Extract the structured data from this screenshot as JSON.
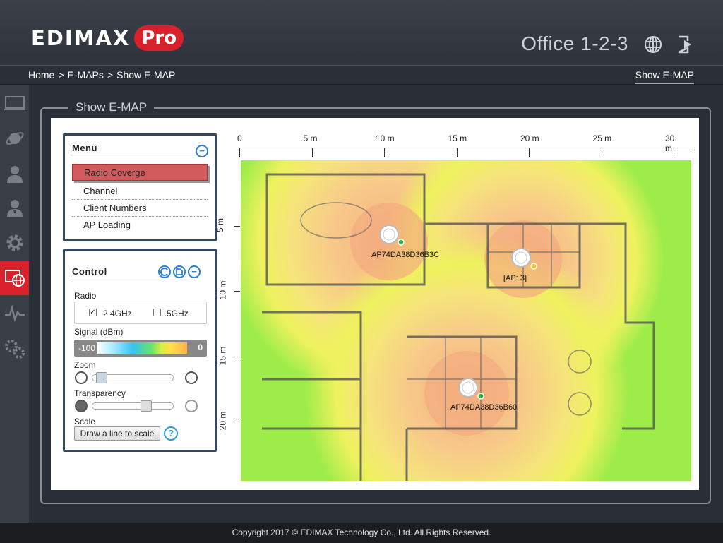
{
  "brand": {
    "logo_main": "EDIMAX",
    "logo_pro": "Pro"
  },
  "header": {
    "site_name": "Office 1-2-3"
  },
  "breadcrumb": {
    "items": [
      "Home",
      "E-MAPs",
      "Show E-MAP"
    ],
    "separator": ">",
    "current_tab": "Show E-MAP"
  },
  "page": {
    "section_title": "Show E-MAP"
  },
  "menu": {
    "title": "Menu",
    "collapse_symbol": "−",
    "items": [
      {
        "label": "Radio Coverge",
        "active": true
      },
      {
        "label": "Channel",
        "active": false
      },
      {
        "label": "Client Numbers",
        "active": false
      },
      {
        "label": "AP Loading",
        "active": false
      }
    ]
  },
  "control": {
    "title": "Control",
    "radio_label": "Radio",
    "radio_24": {
      "label": "2.4GHz",
      "checked": true
    },
    "radio_5": {
      "label": "5GHz",
      "checked": false
    },
    "signal_label": "Signal (dBm)",
    "signal_min": "-100",
    "signal_max": "0",
    "zoom_label": "Zoom",
    "zoom_value": 0.05,
    "transparency_label": "Transparency",
    "transparency_value": 0.68,
    "scale_label": "Scale",
    "scale_button": "Draw a line to scale",
    "help_symbol": "?"
  },
  "map": {
    "x_ticks": [
      "0",
      "5 m",
      "10 m",
      "15 m",
      "20 m",
      "25 m",
      "30 m"
    ],
    "y_ticks": [
      "5 m",
      "10 m",
      "15 m",
      "20 m"
    ],
    "access_points": [
      {
        "label": "AP74DA38D36B3C",
        "status_color": "#2eb34a"
      },
      {
        "label": "[AP: 3]",
        "status_color": "#f2c02c"
      },
      {
        "label": "AP74DA38D36B60",
        "status_color": "#2eb34a"
      }
    ]
  },
  "footer": {
    "copyright": "Copyright 2017 © EDIMAX Technology Co., Ltd. All Rights Reserved."
  }
}
